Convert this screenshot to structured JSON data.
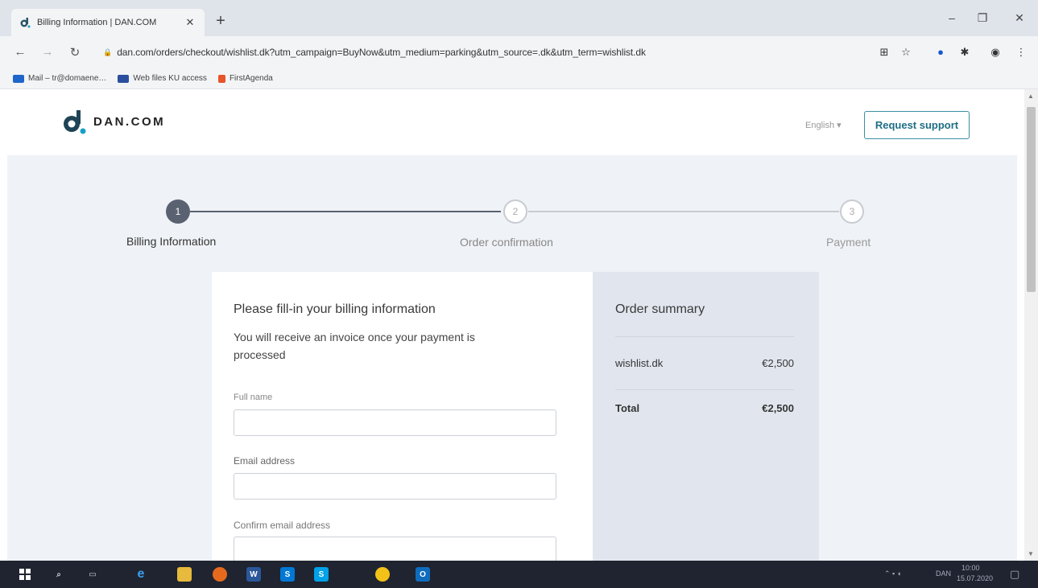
{
  "browser": {
    "tab_title": "Billing Information | DAN.COM",
    "tab_close": "✕",
    "new_tab": "+",
    "url": "dan.com/orders/checkout/wishlist.dk?utm_campaign=BuyNow&utm_medium=parking&utm_source=.dk&utm_term=wishlist.dk",
    "bookmarks": [
      {
        "label": "Mail – tr@domaene…",
        "color": "#1e66c9"
      },
      {
        "label": "Web files KU access",
        "color": "#2a4f9e"
      },
      {
        "label": "FirstAgenda",
        "color": "#e8542a"
      }
    ]
  },
  "header": {
    "logo_text": "DAN.COM",
    "language": "English ▾",
    "support_label": "Request support"
  },
  "stepper": {
    "steps": [
      {
        "number": "1",
        "label": "Billing Information",
        "active": true
      },
      {
        "number": "2",
        "label": "Order confirmation",
        "active": false
      },
      {
        "number": "3",
        "label": "Payment",
        "active": false
      }
    ]
  },
  "form": {
    "title": "Please fill-in your billing information",
    "subtitle": "You will receive an invoice once your payment is processed",
    "fields": [
      {
        "label": "Full name",
        "value": ""
      },
      {
        "label": "Email address",
        "value": ""
      },
      {
        "label": "Confirm email address",
        "value": ""
      }
    ]
  },
  "summary": {
    "title": "Order summary",
    "item_name": "wishlist.dk",
    "item_price": "€2,500",
    "total_label": "Total",
    "total_price": "€2,500"
  },
  "taskbar": {
    "time": "10:00",
    "date": "15.07.2020",
    "lang": "DAN"
  },
  "colors": {
    "accent": "#3c8fa3",
    "step_active": "#5a6272",
    "page_bg": "#eff2f6",
    "summary_bg": "#e1e6ee"
  }
}
